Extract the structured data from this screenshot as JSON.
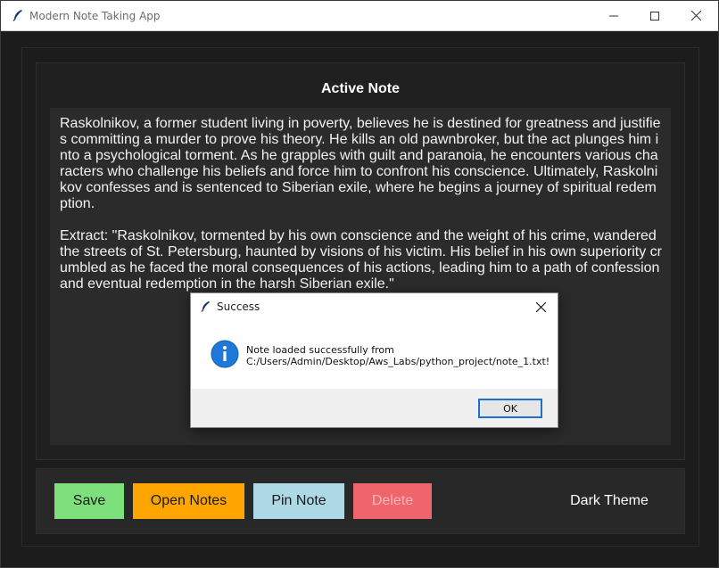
{
  "window": {
    "title": "Modern Note Taking App",
    "icon": "feather-icon"
  },
  "panel": {
    "heading": "Active Note"
  },
  "note": {
    "content": "Raskolnikov, a former student living in poverty, believes he is destined for greatness and justifies committing a murder to prove his theory. He kills an old pawnbroker, but the act plunges him into a psychological torment. As he grapples with guilt and paranoia, he encounters various characters who challenge his beliefs and force him to confront his conscience. Ultimately, Raskolnikov confesses and is sentenced to Siberian exile, where he begins a journey of spiritual redemption.\n\nExtract: \"Raskolnikov, tormented by his own conscience and the weight of his crime, wandered the streets of St. Petersburg, haunted by visions of his victim. His belief in his own superiority crumbled as he faced the moral consequences of his actions, leading him to a path of confession and eventual redemption in the harsh Siberian exile.\""
  },
  "toolbar": {
    "save_label": "Save",
    "open_label": "Open Notes",
    "pin_label": "Pin Note",
    "delete_label": "Delete",
    "theme_label": "Dark Theme"
  },
  "dialog": {
    "title": "Success",
    "message": "Note loaded successfully from\nC:/Users/Admin/Desktop/Aws_Labs/python_project/note_1.txt!",
    "ok_label": "OK",
    "icon": "info-icon"
  },
  "colors": {
    "save": "#7de07d",
    "open": "#ffa500",
    "pin": "#add8e6",
    "delete": "#f0646c",
    "background": "#1c1c1c"
  }
}
